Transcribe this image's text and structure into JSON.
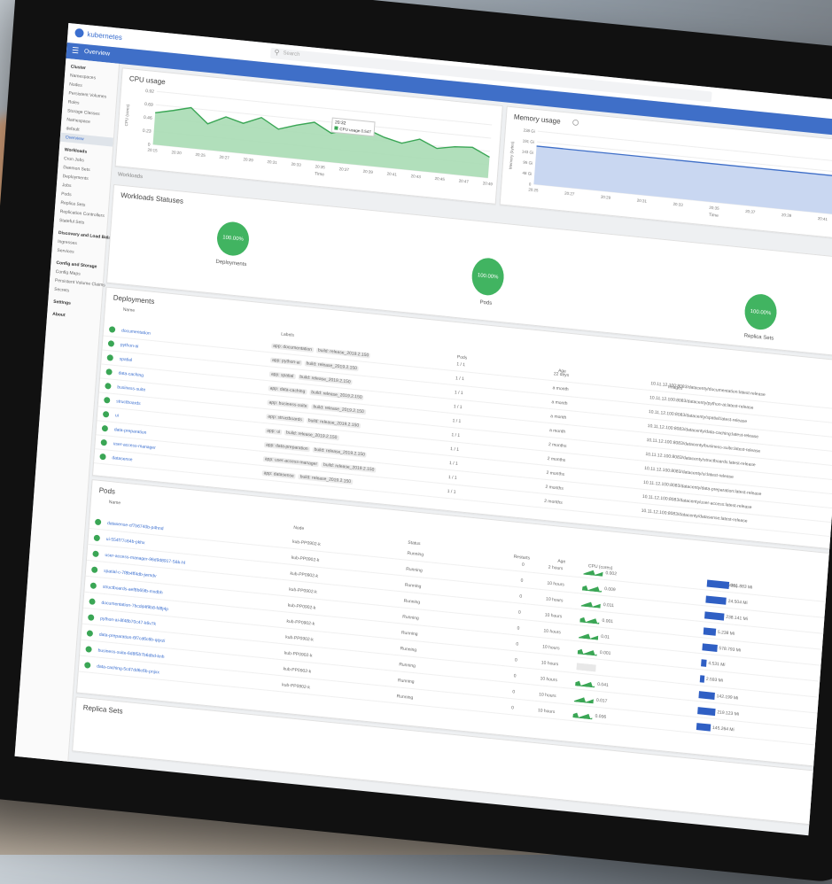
{
  "app": {
    "brand": "kubernetes",
    "search_placeholder": "Search",
    "page_title": "Overview"
  },
  "sidebar": {
    "cluster_head": "Cluster",
    "cluster_items": [
      "Namespaces",
      "Nodes",
      "Persistent Volumes",
      "Roles",
      "Storage Classes"
    ],
    "namespace_label": "Namespace",
    "namespace_value": "default",
    "overview": "Overview",
    "workloads_head": "Workloads",
    "workload_items": [
      "Cron Jobs",
      "Daemon Sets",
      "Deployments",
      "Jobs",
      "Pods",
      "Replica Sets",
      "Replication Controllers",
      "Stateful Sets"
    ],
    "discovery_head": "Discovery and Load Balancing",
    "discovery_items": [
      "Ingresses",
      "Services"
    ],
    "config_head": "Config and Storage",
    "config_items": [
      "Config Maps",
      "Persistent Volume Claims",
      "Secrets"
    ],
    "settings": "Settings",
    "about": "About"
  },
  "cpu_chart": {
    "title": "CPU usage",
    "ylabel": "CPU (cores)",
    "xlabel": "Time",
    "yticks": [
      "0.92",
      "0.69",
      "0.46",
      "0.23",
      "0"
    ],
    "xticks": [
      "20:15",
      "20:20",
      "20:25",
      "20:27",
      "20:29",
      "20:31",
      "20:33",
      "20:35",
      "20:37",
      "20:39",
      "20:41",
      "20:43",
      "20:45",
      "20:47",
      "20:49"
    ],
    "tooltip_time": "20:32",
    "tooltip_text": "CPU usage   0.547",
    "color": "#3aa655",
    "values": [
      0.55,
      0.62,
      0.7,
      0.45,
      0.6,
      0.52,
      0.65,
      0.48,
      0.58,
      0.66,
      0.5,
      0.6,
      0.63,
      0.52,
      0.45,
      0.55,
      0.42,
      0.48,
      0.5,
      0.36
    ]
  },
  "mem_chart": {
    "title": "Memory usage",
    "ylabel": "Memory (bytes)",
    "xlabel": "Time",
    "yticks": [
      "238 Gi",
      "191 Gi",
      "143 Gi",
      "95 Gi",
      "48 Gi",
      "0"
    ],
    "xticks": [
      "20:25",
      "20:27",
      "20:29",
      "20:31",
      "20:33",
      "20:35",
      "20:37",
      "20:39",
      "20:41",
      "20:43",
      "20:45"
    ],
    "color": "#3f6fc8",
    "value": 0.72
  },
  "workloads_label": "Workloads",
  "statuses": {
    "title": "Workloads Statuses",
    "items": [
      {
        "name": "Deployments",
        "pct": "100.00%"
      },
      {
        "name": "Pods",
        "pct": "100.00%"
      },
      {
        "name": "Replica Sets",
        "pct": "100.00%"
      }
    ]
  },
  "deployments": {
    "title": "Deployments",
    "name_header": "Name",
    "labels_header": "Labels",
    "pods_header": "Pods",
    "age_header": "Age",
    "images_header": "Images",
    "rows": [
      {
        "name": "documentation",
        "app": "app: documentation",
        "build": "build: release_2019.2.150",
        "pods": "1 / 1",
        "age": "22 days",
        "image": "10.11.12.100:8083/datacenty/documentation:latest-release"
      },
      {
        "name": "python-ai",
        "app": "app: python-ai",
        "build": "build: release_2019.2.150",
        "pods": "1 / 1",
        "age": "a month",
        "image": "10.11.12.100:8083/datacenty/python-ai:latest-release"
      },
      {
        "name": "spatial",
        "app": "app: spatial",
        "build": "build: release_2019.2.150",
        "pods": "1 / 1",
        "age": "a month",
        "image": "10.11.12.100:8083/datacenty/spatial:latest-release"
      },
      {
        "name": "data-caching",
        "app": "app: data-caching",
        "build": "build: release_2019.2.150",
        "pods": "1 / 1",
        "age": "a month",
        "image": "10.11.12.100:8083/datacenty/data-caching:latest-release"
      },
      {
        "name": "business-suite",
        "app": "app: business-suite",
        "build": "build: release_2019.2.150",
        "pods": "1 / 1",
        "age": "a month",
        "image": "10.11.12.100:8083/datacenty/business-suite:latest-release"
      },
      {
        "name": "structboards",
        "app": "app: structboards",
        "build": "build: release_2019.2.150",
        "pods": "1 / 1",
        "age": "2 months",
        "image": "10.11.12.100:8083/datacenty/structboards:latest-release"
      },
      {
        "name": "ui",
        "app": "app: ui",
        "build": "build: release_2019.2.150",
        "pods": "1 / 1",
        "age": "2 months",
        "image": "10.11.12.100:8083/datacenty/ui:latest-release"
      },
      {
        "name": "data-preparation",
        "app": "app: data-preparation",
        "build": "build: release_2019.2.150",
        "pods": "1 / 1",
        "age": "2 months",
        "image": "10.11.12.100:8083/datacenty/data-preparation:latest-release"
      },
      {
        "name": "user-access-manager",
        "app": "app: user-access-manager",
        "build": "build: release_2019.2.150",
        "pods": "1 / 1",
        "age": "2 months",
        "image": "10.11.12.100:8083/datacenty/user-access:latest-release"
      },
      {
        "name": "datasense",
        "app": "app: datasense",
        "build": "build: release_2019.2.150",
        "pods": "1 / 1",
        "age": "2 months",
        "image": "10.11.12.100:8083/datacenty/datasense:latest-release"
      }
    ]
  },
  "pods": {
    "title": "Pods",
    "name_header": "Name",
    "node_header": "Node",
    "status_header": "Status",
    "restarts_header": "Restarts",
    "age_header": "Age",
    "cpu_header": "CPU (cores)",
    "mem_header": "Memory (bytes)",
    "rows": [
      {
        "name": "datasense-cf7b6740b-p4hnd",
        "node": "kub-PP0902-k",
        "status": "Running",
        "restarts": "0",
        "age": "2 hours",
        "cpu": "0.002",
        "mem": "261.883 Mi",
        "mem_frac": 0.62
      },
      {
        "name": "ui-554f77c64b-pkhx",
        "node": "kub-PP0902-k",
        "status": "Running",
        "restarts": "0",
        "age": "10 hours",
        "cpu": "0.009",
        "mem": "24.504 Mi",
        "mem_frac": 0.58
      },
      {
        "name": "user-access-manager-96d9d8917-5&k-hl",
        "node": "kub-PP0902-k",
        "status": "Running",
        "restarts": "0",
        "age": "10 hours",
        "cpu": "0.011",
        "mem": "238.141 Mi",
        "mem_frac": 0.55
      },
      {
        "name": "spatial-c-7f8b4ff4db-jwmdv",
        "node": "kub-PP0902-k",
        "status": "Running",
        "restarts": "0",
        "age": "10 hours",
        "cpu": "0.001",
        "mem": "5.238 Mi",
        "mem_frac": 0.35
      },
      {
        "name": "structboards-aef8b65fb-mxdbh",
        "node": "kub-PP0902-k",
        "status": "Running",
        "restarts": "0",
        "age": "10 hours",
        "cpu": "0.01",
        "mem": "578.793 Mi",
        "mem_frac": 0.42
      },
      {
        "name": "documentation-7bcdd4f9b8-fd8j4p",
        "node": "kub-PP0902-k",
        "status": "Running",
        "restarts": "0",
        "age": "10 hours",
        "cpu": "0.001",
        "mem": "4.531 Mi",
        "mem_frac": 0.15
      },
      {
        "name": "python-ai-8f48b70c47-k6v7k",
        "node": "kub-PP0902-k",
        "status": "Running",
        "restarts": "0",
        "age": "10 hours",
        "cpu": "",
        "mem": "2.593 Mi",
        "mem_frac": 0.12
      },
      {
        "name": "data-preparation-6f7cd6c6b-qqxzi",
        "node": "kub-PP0902-k",
        "status": "Running",
        "restarts": "0",
        "age": "10 hours",
        "cpu": "0.041",
        "mem": "142.199 Mi",
        "mem_frac": 0.45
      },
      {
        "name": "business-suite-6d8f5b7b6dbd-knh",
        "node": "kub-PP0902-k",
        "status": "Running",
        "restarts": "0",
        "age": "10 hours",
        "cpu": "0.017",
        "mem": "219.123 Mi",
        "mem_frac": 0.5
      },
      {
        "name": "data-caching-5cd7dd6c6b-pnjxx",
        "node": "kub-PP0902-k",
        "status": "Running",
        "restarts": "0",
        "age": "10 hours",
        "cpu": "0.006",
        "mem": "145.264 Mi",
        "mem_frac": 0.4
      }
    ]
  },
  "replica_sets": {
    "title": "Replica Sets"
  }
}
